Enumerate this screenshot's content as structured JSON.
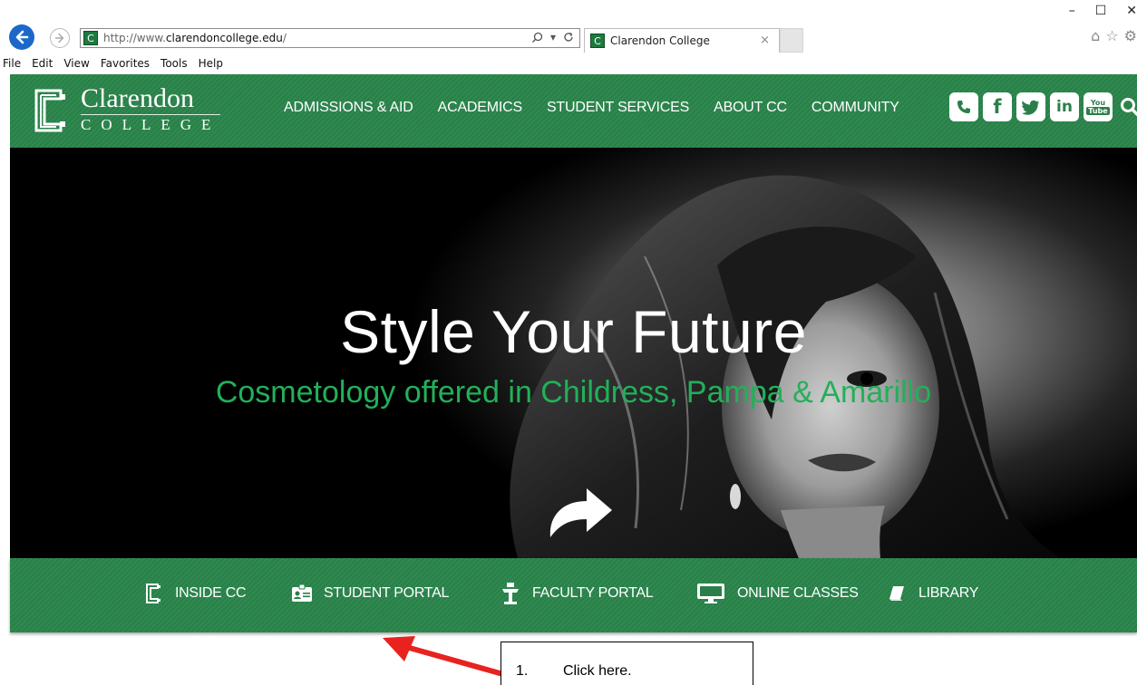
{
  "browser": {
    "url_prefix": "http://www.",
    "url_domain": "clarendoncollege.edu",
    "url_suffix": "/",
    "tab_title": "Clarendon College",
    "tab_close": "×",
    "menu": [
      "File",
      "Edit",
      "View",
      "Favorites",
      "Tools",
      "Help"
    ],
    "window_controls": [
      "–",
      "☐",
      "✕"
    ],
    "toolbar_icons": [
      "home-icon",
      "star-icon",
      "gear-icon"
    ]
  },
  "site": {
    "logo_name": "Clarendon",
    "logo_sub": "COLLEGE",
    "nav": [
      "ADMISSIONS & AID",
      "ACADEMICS",
      "STUDENT SERVICES",
      "ABOUT CC",
      "COMMUNITY"
    ],
    "social": [
      "phone-icon",
      "facebook-icon",
      "twitter-icon",
      "linkedin-icon",
      "youtube-icon",
      "search-icon"
    ],
    "social_glyphs": [
      "✆",
      "f",
      "t",
      "in",
      "You\nTube"
    ]
  },
  "hero": {
    "title": "Style Your Future",
    "subtitle": "Cosmetology offered in Childress, Pampa & Amarillo",
    "subtitle_color": "#22b05a"
  },
  "quick_links": [
    {
      "label": "INSIDE CC",
      "icon": "college-c-icon"
    },
    {
      "label": "STUDENT PORTAL",
      "icon": "id-card-icon"
    },
    {
      "label": "FACULTY PORTAL",
      "icon": "lectern-icon"
    },
    {
      "label": "ONLINE CLASSES",
      "icon": "monitor-icon"
    },
    {
      "label": "LIBRARY",
      "icon": "book-icon"
    }
  ],
  "annotation": {
    "number": "1.",
    "text": "Click here.",
    "arrow_color": "#e8231f"
  },
  "colors": {
    "brand_green": "#2a7f49",
    "back_button": "#1c68c9"
  }
}
